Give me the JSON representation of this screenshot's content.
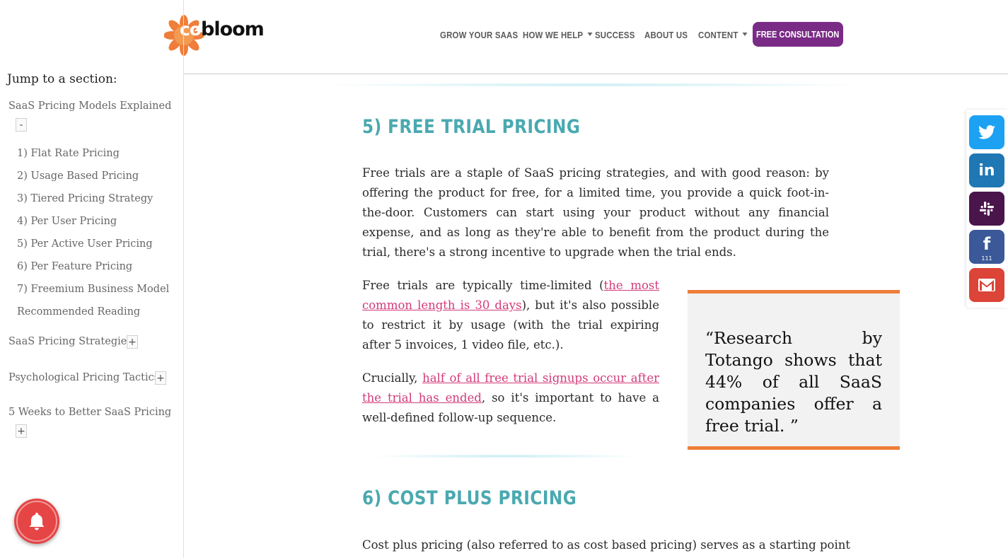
{
  "header": {
    "logo_text_prefix": "co",
    "logo_text_main": "bloom",
    "nav": [
      {
        "label": "GROW YOUR SAAS",
        "has_caret": false
      },
      {
        "label": "HOW WE HELP",
        "has_caret": true
      },
      {
        "label": "SUCCESS",
        "has_caret": false
      },
      {
        "label": "ABOUT US",
        "has_caret": false
      },
      {
        "label": "CONTENT",
        "has_caret": true
      }
    ],
    "cta_label": "FREE CONSULTATION",
    "colors": {
      "brand_orange": "#ee7e3a",
      "cta_purple": "#7a2b86"
    }
  },
  "sidebar": {
    "title": "Jump to a section:",
    "sections": [
      {
        "label": "SaaS Pricing Models Explained",
        "toggle": "-",
        "items": [
          "1) Flat Rate Pricing",
          "2) Usage Based Pricing",
          "3) Tiered Pricing Strategy",
          "4) Per User Pricing",
          "5) Per Active User Pricing",
          "6) Per Feature Pricing",
          "7) Freemium Business Model",
          "Recommended Reading"
        ]
      },
      {
        "label": "SaaS Pricing Strategies",
        "toggle": "+"
      },
      {
        "label": "Psychological Pricing Tactics",
        "toggle": "+"
      },
      {
        "label": "5 Weeks to Better SaaS Pricing",
        "toggle": "+"
      }
    ]
  },
  "main": {
    "section5_heading": "5) FREE TRIAL PRICING",
    "p1": "Free trials are a staple of SaaS pricing strategies, and with good reason: by offering the product for free, for a limited time, you provide a quick foot-in-the-door. Customers can start using your product without any financial expense, and as long as they're able to benefit from the product during the trial, there's a strong incentive to upgrade when the trial ends.",
    "p2_before": "Free trials are typically time-limited (",
    "p2_link": "the most common length is 30 days",
    "p2_after": "), but it's also possible to restrict it by usage (with the trial expiring after 5 invoices, 1 video file, etc.).",
    "p3_before": "Crucially, ",
    "p3_link": "half of all free trial signups occur after the trial has ended",
    "p3_after": ", so it's important to have a well-defined follow-up sequence.",
    "quote": "“Research by Totango shows that 44% of all SaaS companies  offer a free trial. ”",
    "section6_heading": "6) COST PLUS PRICING",
    "p4": "Cost plus pricing (also referred to as cost based pricing) serves as a starting point",
    "colors": {
      "heading_teal": "#4aa9b0",
      "link_pink": "#d23a7a",
      "quote_border": "#ee7e3a"
    }
  },
  "share": {
    "buttons": [
      {
        "name": "twitter",
        "icon": "twitter-icon",
        "color": "#1da1f2"
      },
      {
        "name": "linkedin",
        "icon": "linkedin-icon",
        "color": "#1f77b4"
      },
      {
        "name": "slack",
        "icon": "slack-icon",
        "color": "#4a154b"
      },
      {
        "name": "facebook",
        "icon": "facebook-icon",
        "color": "#3b5998",
        "count": "111"
      },
      {
        "name": "gmail",
        "icon": "gmail-icon",
        "color": "#db4437"
      }
    ]
  },
  "notification": {
    "icon": "bell-icon",
    "color": "#e54545"
  }
}
